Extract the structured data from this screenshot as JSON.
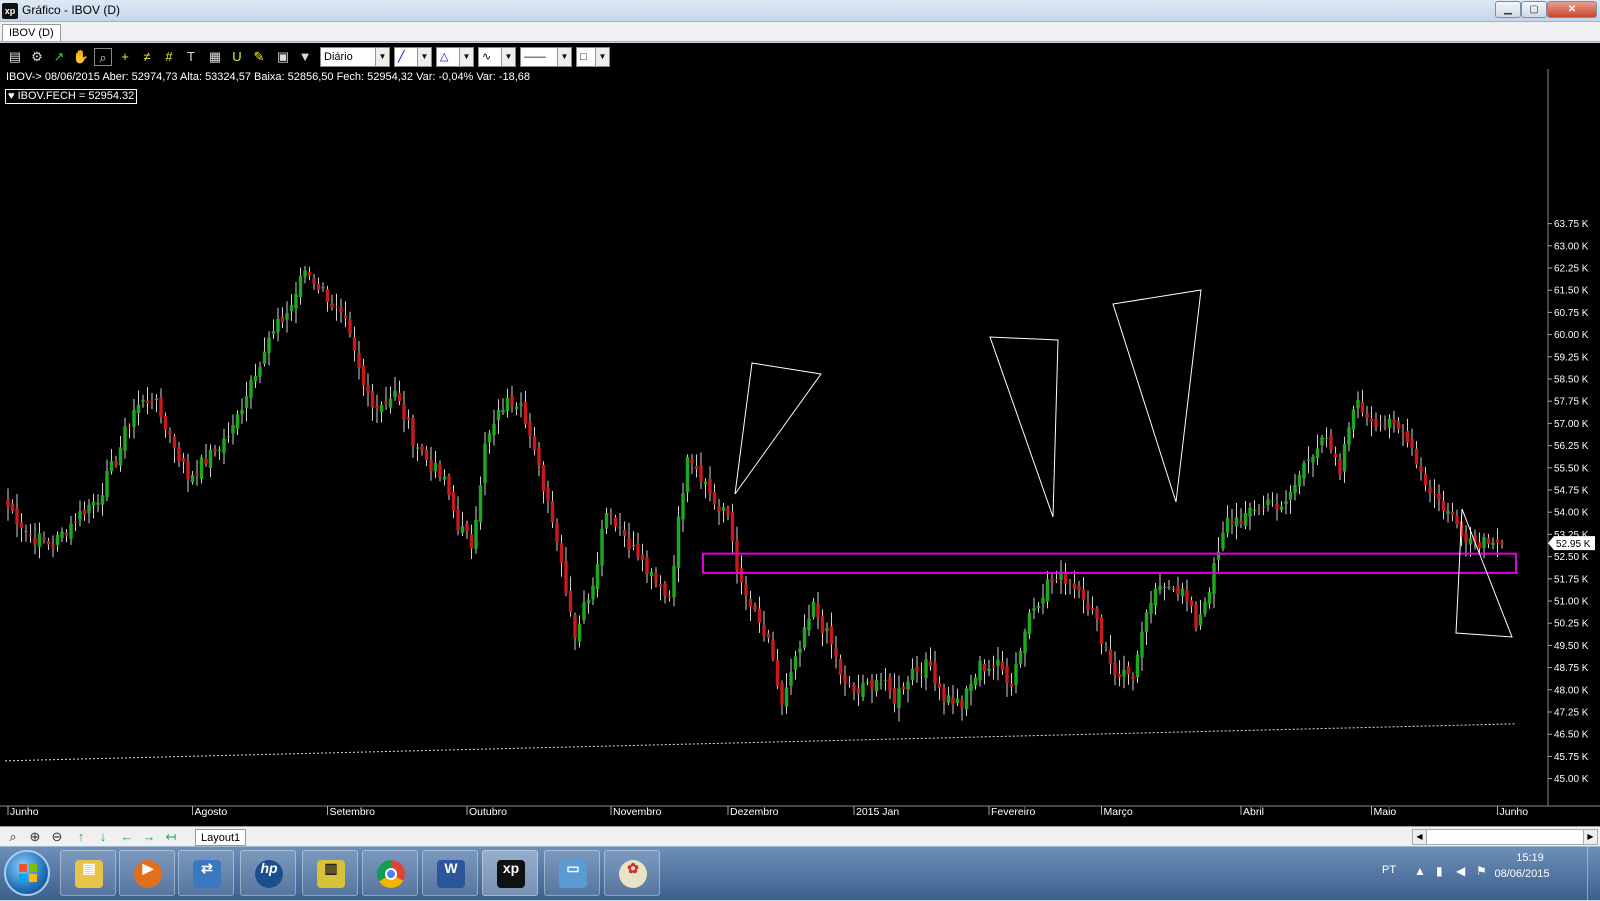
{
  "window": {
    "title": "Gráfico - IBOV (D)",
    "min_label": "▁",
    "max_label": "▢",
    "close_label": "✕"
  },
  "tabs": {
    "active": "IBOV (D)"
  },
  "toolbar": {
    "period_label": "Diário"
  },
  "info": {
    "ohlc_line": "IBOV-> 08/06/2015 Aber: 52974,73 Alta: 53324,57 Baixa: 52856,50 Fech: 52954,32 Var: -0,04% Var: -18,68",
    "legend": "IBOV.FECH = 52954.32",
    "last_price_label": "52.95 K"
  },
  "colors": {
    "up": "#1ea81e",
    "down": "#c8191b",
    "wick": "#d0d0d0",
    "support_band": "#e000e0",
    "drawings": "#ffffff",
    "last_price_bg": "#ffffff"
  },
  "chart_data": {
    "type": "candlestick",
    "symbol": "IBOV",
    "period": "Diário",
    "ylim": [
      44500,
      64000
    ],
    "y_ticks": [
      "45.00 K",
      "45.75 K",
      "46.50 K",
      "47.25 K",
      "48.00 K",
      "48.75 K",
      "49.50 K",
      "50.25 K",
      "51.00 K",
      "51.75 K",
      "52.50 K",
      "53.25 K",
      "54.00 K",
      "54.75 K",
      "55.50 K",
      "56.25 K",
      "57.00 K",
      "57.75 K",
      "58.50 K",
      "59.25 K",
      "60.00 K",
      "60.75 K",
      "61.50 K",
      "62.25 K",
      "63.00 K",
      "63.75 K"
    ],
    "x_ticks": [
      {
        "label": "Junho",
        "bar": 0
      },
      {
        "label": "Agosto",
        "bar": 41
      },
      {
        "label": "Setembro",
        "bar": 71
      },
      {
        "label": "Outubro",
        "bar": 102
      },
      {
        "label": "Novembro",
        "bar": 134
      },
      {
        "label": "Dezembro",
        "bar": 160
      },
      {
        "label": "2015 Jan",
        "bar": 188
      },
      {
        "label": "Fevereiro",
        "bar": 218
      },
      {
        "label": "Março",
        "bar": 243
      },
      {
        "label": "Abril",
        "bar": 274
      },
      {
        "label": "Maio",
        "bar": 303
      },
      {
        "label": "Junho",
        "bar": 331
      }
    ],
    "anchors": [
      [
        0,
        54200
      ],
      [
        5,
        53200
      ],
      [
        10,
        52900
      ],
      [
        15,
        53800
      ],
      [
        20,
        54500
      ],
      [
        24,
        55800
      ],
      [
        28,
        57500
      ],
      [
        32,
        57900
      ],
      [
        36,
        56600
      ],
      [
        40,
        55200
      ],
      [
        45,
        55900
      ],
      [
        50,
        56800
      ],
      [
        54,
        58500
      ],
      [
        58,
        59800
      ],
      [
        63,
        61000
      ],
      [
        66,
        62200
      ],
      [
        71,
        61300
      ],
      [
        75,
        60300
      ],
      [
        79,
        58200
      ],
      [
        82,
        57600
      ],
      [
        86,
        58000
      ],
      [
        90,
        56500
      ],
      [
        93,
        55800
      ],
      [
        97,
        55000
      ],
      [
        100,
        53600
      ],
      [
        103,
        52900
      ],
      [
        106,
        56200
      ],
      [
        110,
        57600
      ],
      [
        114,
        57900
      ],
      [
        117,
        55900
      ],
      [
        121,
        53900
      ],
      [
        124,
        51500
      ],
      [
        126,
        49900
      ],
      [
        130,
        51700
      ],
      [
        133,
        54200
      ],
      [
        136,
        53500
      ],
      [
        140,
        52500
      ],
      [
        144,
        51500
      ],
      [
        147,
        51200
      ],
      [
        151,
        56100
      ],
      [
        154,
        55300
      ],
      [
        158,
        54000
      ],
      [
        160,
        53900
      ],
      [
        163,
        51400
      ],
      [
        166,
        50500
      ],
      [
        169,
        49500
      ],
      [
        172,
        47500
      ],
      [
        175,
        48900
      ],
      [
        179,
        50800
      ],
      [
        183,
        49500
      ],
      [
        186,
        48100
      ],
      [
        189,
        47900
      ],
      [
        193,
        48400
      ],
      [
        197,
        47700
      ],
      [
        201,
        48700
      ],
      [
        205,
        48800
      ],
      [
        208,
        47800
      ],
      [
        212,
        47500
      ],
      [
        216,
        48800
      ],
      [
        220,
        48800
      ],
      [
        223,
        48300
      ],
      [
        227,
        50600
      ],
      [
        231,
        51600
      ],
      [
        235,
        51800
      ],
      [
        239,
        51300
      ],
      [
        242,
        50200
      ],
      [
        246,
        48600
      ],
      [
        250,
        48500
      ],
      [
        254,
        51000
      ],
      [
        258,
        51700
      ],
      [
        261,
        51300
      ],
      [
        264,
        50200
      ],
      [
        267,
        51500
      ],
      [
        271,
        53700
      ],
      [
        276,
        53900
      ],
      [
        280,
        54400
      ],
      [
        284,
        54200
      ],
      [
        288,
        55600
      ],
      [
        292,
        56600
      ],
      [
        296,
        55300
      ],
      [
        299,
        57700
      ],
      [
        303,
        57200
      ],
      [
        307,
        56900
      ],
      [
        311,
        56600
      ],
      [
        315,
        55000
      ],
      [
        319,
        54200
      ],
      [
        323,
        53400
      ],
      [
        326,
        53000
      ],
      [
        330,
        53200
      ],
      [
        332,
        52954
      ]
    ],
    "moving_average": {
      "style": "dotted",
      "start": 45600,
      "end": 46850
    },
    "support_band": {
      "upper": 52600,
      "lower": 51950
    },
    "last_close": 52954.32
  }
}
